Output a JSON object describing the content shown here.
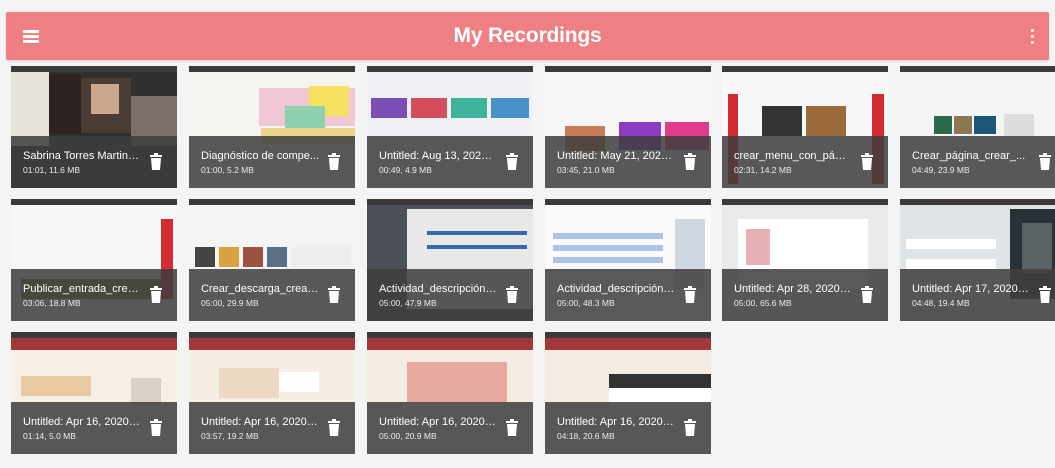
{
  "header": {
    "title": "My Recordings",
    "background": "#ee8084",
    "menu_icon": "hamburger-menu-icon",
    "more_icon": "vertical-dots-icon"
  },
  "recordings": [
    {
      "name": "Sabrina Torres Martine...",
      "duration": "01:01",
      "size": "11.6 MB"
    },
    {
      "name": "Diagnóstico de compe...",
      "duration": "01:00",
      "size": "5.2 MB"
    },
    {
      "name": "Untitled: Aug 13, 2020 ...",
      "duration": "00:49",
      "size": "4.9 MB"
    },
    {
      "name": "Untitled: May 21, 2020 ...",
      "duration": "03:45",
      "size": "21.0 MB"
    },
    {
      "name": "crear_menu_con_pági...",
      "duration": "02:31",
      "size": "14.2 MB"
    },
    {
      "name": "Crear_página_crear_...",
      "duration": "04:49",
      "size": "23.9 MB"
    },
    {
      "name": "Publicar_entrada_crea...",
      "duration": "03:06",
      "size": "18.8 MB"
    },
    {
      "name": "Crear_descarga_crear...",
      "duration": "05:00",
      "size": "29.9 MB"
    },
    {
      "name": "Actividad_descripción_3",
      "duration": "05:00",
      "size": "47.9 MB"
    },
    {
      "name": "Actividad_descripción_2",
      "duration": "05:00",
      "size": "48.3 MB"
    },
    {
      "name": "Untitled: Apr 28, 2020 ...",
      "duration": "05:00",
      "size": "65.6 MB"
    },
    {
      "name": "Untitled: Apr 17, 2020 ...",
      "duration": "04:48",
      "size": "19.4 MB"
    },
    {
      "name": "Untitled: Apr 16, 2020 ...",
      "duration": "01:14",
      "size": "5.0 MB"
    },
    {
      "name": "Untitled: Apr 16, 2020 ...",
      "duration": "03:57",
      "size": "19.2 MB"
    },
    {
      "name": "Untitled: Apr 16, 2020 ...",
      "duration": "05:00",
      "size": "20.9 MB"
    },
    {
      "name": "Untitled: Apr 16, 2020 ...",
      "duration": "04:18",
      "size": "20.6 MB"
    }
  ],
  "delete_icon": "trash-icon"
}
